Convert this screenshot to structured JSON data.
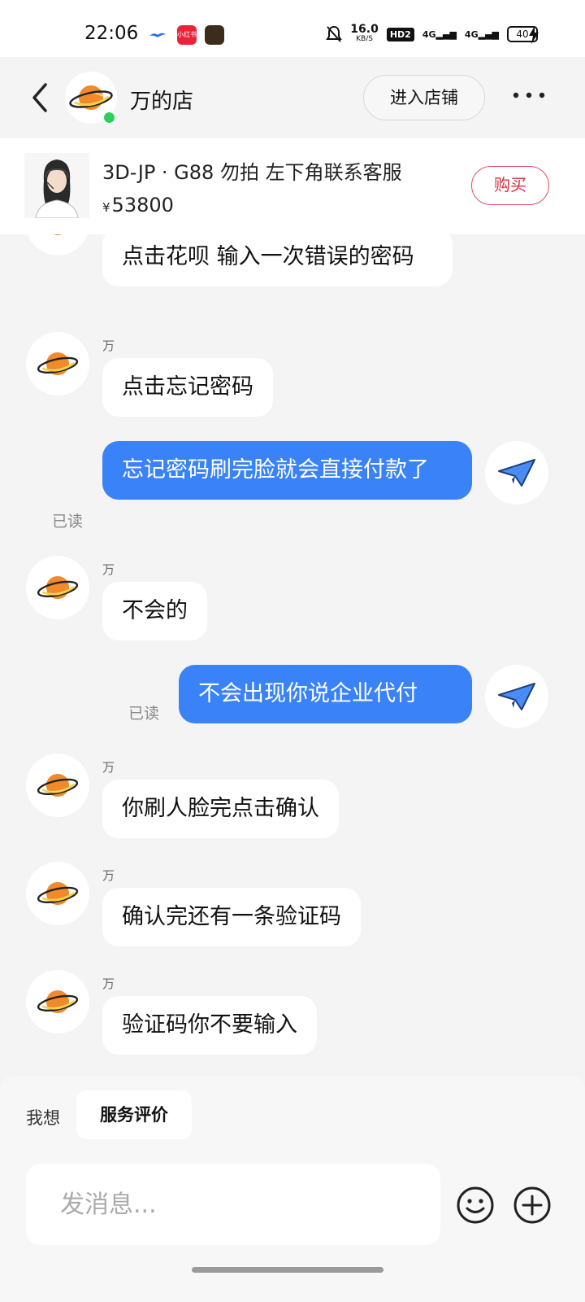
{
  "status_bar": {
    "time": "22:06",
    "net_speed": "16.0",
    "net_unit": "KB/S",
    "hd": "HD2",
    "signal1": "4G",
    "signal2": "4G",
    "battery": "40",
    "red_app_label": "小红书"
  },
  "header": {
    "shop_name": "万的店",
    "enter_shop_label": "进入店铺",
    "online_color": "#2fce5b"
  },
  "product": {
    "title": "3D-JP · G88 勿拍 左下角联系客服",
    "currency": "¥",
    "price": "53800",
    "buy_label": "购买"
  },
  "messages": [
    {
      "side": "in",
      "sender": "",
      "text": "点击花呗 输入一次错误的密码"
    },
    {
      "side": "in",
      "sender": "万",
      "text": "点击忘记密码"
    },
    {
      "side": "out",
      "status": "已读",
      "text": "忘记密码刷完脸就会直接付款了"
    },
    {
      "side": "in",
      "sender": "万",
      "text": "不会的"
    },
    {
      "side": "out",
      "status": "已读",
      "text": "不会出现你说企业代付"
    },
    {
      "side": "in",
      "sender": "万",
      "text": "你刷人脸完点击确认"
    },
    {
      "side": "in",
      "sender": "万",
      "text": "确认完还有一条验证码"
    },
    {
      "side": "in",
      "sender": "万",
      "text": "验证码你不要输入"
    }
  ],
  "bottom": {
    "quick_label": "我想",
    "quick_chip": "服务评价",
    "input_placeholder": "发消息..."
  },
  "colors": {
    "outgoing_bubble": "#3a82f7",
    "buy_border": "#e0505e",
    "planet": "#f08a2a"
  },
  "icons": {
    "back": "chevron-left-icon",
    "more": "more-dots-icon",
    "planet": "planet-icon",
    "plane": "paper-plane-icon",
    "emoji": "emoji-icon",
    "plus": "plus-circle-icon"
  }
}
